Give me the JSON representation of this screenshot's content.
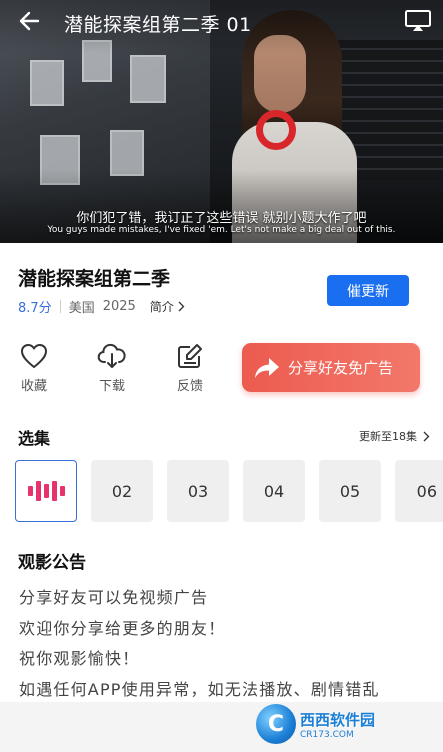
{
  "player": {
    "title": "潜能探案组第二季 01",
    "subtitle_cn": "你们犯了错，我订正了这些错误 就别小题大作了吧",
    "subtitle_en": "You guys made mistakes, I've fixed 'em. Let's not make a big deal out of this."
  },
  "info": {
    "title": "潜能探案组第二季",
    "score": "8.7分",
    "region": "美国",
    "year": "2025",
    "intro_label": "简介",
    "urge_label": "催更新"
  },
  "actions": {
    "favorite": "收藏",
    "download": "下载",
    "feedback": "反馈",
    "share": "分享好友免广告"
  },
  "episodes": {
    "title": "选集",
    "update_text": "更新至18集",
    "items": [
      "02",
      "03",
      "04",
      "05",
      "06"
    ]
  },
  "notice": {
    "title": "观影公告",
    "lines": [
      "分享好友可以免视频广告",
      "欢迎你分享给更多的朋友！",
      "祝你观影愉快！",
      "如遇任何APP使用异常，如无法播放、剧情错乱"
    ]
  },
  "watermark": {
    "logo_letter": "C",
    "name": "西西软件园",
    "domain": "CR173.COM"
  },
  "colors": {
    "accent_blue": "#1a6ff1",
    "share_red": "#ec5b4f",
    "episode_bar_pink": "#e6336b"
  }
}
